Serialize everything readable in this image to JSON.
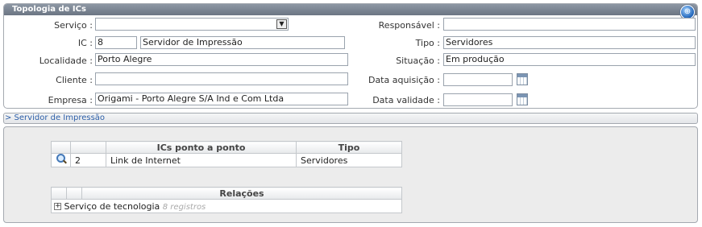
{
  "panel": {
    "title": "Topologia de ICs",
    "help_glyph": "⊕"
  },
  "form": {
    "servico_label": "Serviço :",
    "servico_value": "",
    "ic_label": "IC :",
    "ic_number": "8",
    "ic_name": "Servidor de Impressão",
    "localidade_label": "Localidade :",
    "localidade_value": "Porto Alegre",
    "cliente_label": "Cliente :",
    "cliente_value": "",
    "empresa_label": "Empresa :",
    "empresa_value": "Origami - Porto Alegre S/A Ind e Com Ltda",
    "responsavel_label": "Responsável :",
    "responsavel_value": "",
    "tipo_label": "Tipo :",
    "tipo_value": "Servidores",
    "situacao_label": "Situação :",
    "situacao_value": "Em produção",
    "data_aquisicao_label": "Data aquisição :",
    "data_aquisicao_value": "",
    "data_validade_label": "Data validade :",
    "data_validade_value": ""
  },
  "section": {
    "link_text": "> Servidor de Impressão"
  },
  "ics_table": {
    "headers": [
      "",
      "",
      "ICs ponto a ponto",
      "Tipo"
    ],
    "rows": [
      {
        "id": "2",
        "name": "Link de Internet",
        "tipo": "Servidores"
      }
    ]
  },
  "relacoes_table": {
    "header": "Relações",
    "rows": [
      {
        "label": "Serviço de tecnologia",
        "count": "8 registros"
      }
    ]
  },
  "icons": {
    "select_arrow": "▼",
    "expand": "+"
  }
}
